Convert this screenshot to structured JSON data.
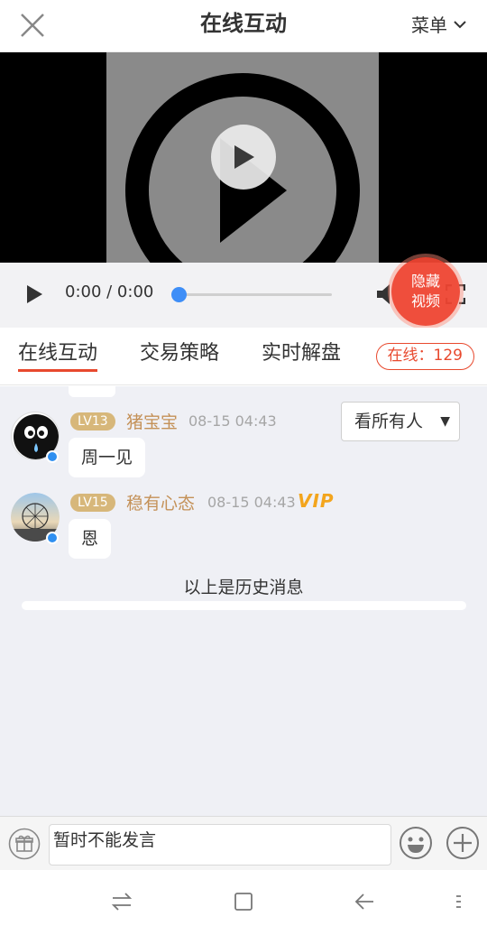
{
  "header": {
    "title": "在线互动",
    "menu_label": "菜单"
  },
  "player": {
    "time": "0:00 / 0:00",
    "progress": 0,
    "hide_video_line1": "隐藏",
    "hide_video_line2": "视频"
  },
  "tabs": [
    {
      "label": "在线互动",
      "active": true
    },
    {
      "label": "交易策略",
      "active": false
    },
    {
      "label": "实时解盘",
      "active": false
    }
  ],
  "online": {
    "label": "在线：129"
  },
  "filter": {
    "selected": "看所有人"
  },
  "messages": [
    {
      "level": "LV13",
      "user": "猪宝宝",
      "time": "08-15 04:43",
      "text": "周一见",
      "vip": false
    },
    {
      "level": "LV15",
      "user": "稳有心态",
      "time": "08-15 04:43",
      "text": "恩",
      "vip": true,
      "vip_label": "VIP"
    }
  ],
  "history_notice": "以上是历史消息",
  "input": {
    "value": "暂时不能发言"
  },
  "colors": {
    "accent": "#e8492e",
    "blue": "#3e8ef7",
    "username": "#c49158",
    "level_badge": "#d7b77a",
    "chat_bg": "#eff0f5"
  },
  "icons": [
    "close-icon",
    "chevron-down-icon",
    "play-icon",
    "volume-icon",
    "fullscreen-icon",
    "gift-icon",
    "emoji-icon",
    "plus-icon",
    "switch-apps-icon",
    "home-icon",
    "back-icon",
    "menu-icon"
  ]
}
